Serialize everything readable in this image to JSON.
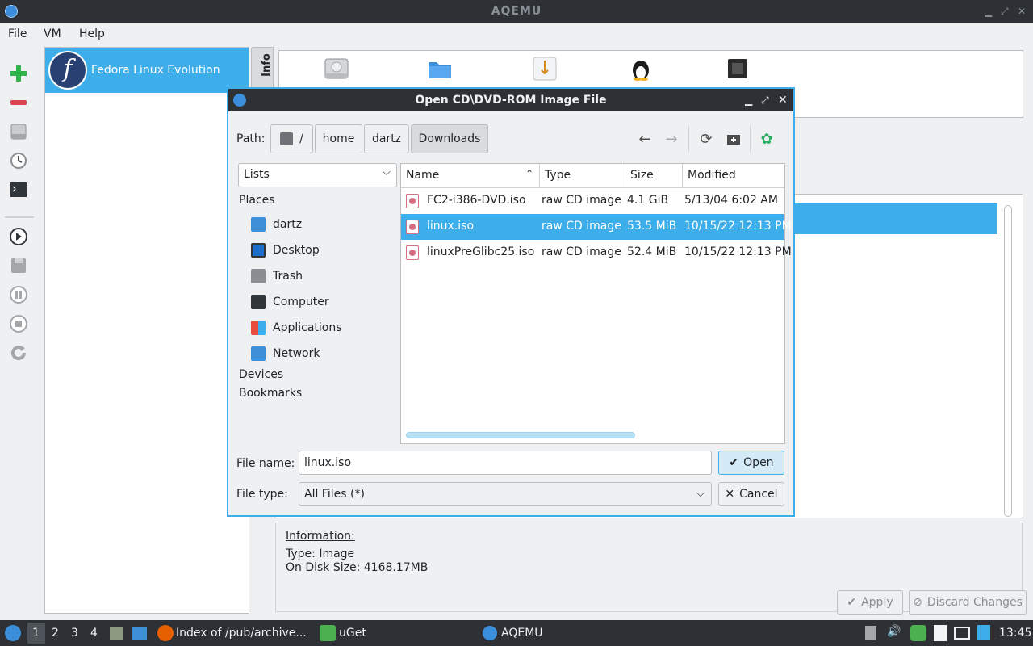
{
  "window": {
    "title": "AQEMU"
  },
  "menubar": {
    "items": [
      "File",
      "VM",
      "Help"
    ]
  },
  "vm_list": {
    "items": [
      {
        "name": "Fedora Linux Evolution",
        "logo_letter": "f"
      }
    ]
  },
  "info_tab": {
    "label": "Info"
  },
  "info_section": {
    "heading": "Information:",
    "type_line": "Type: Image",
    "disk_line": "On Disk Size: 4168.17MB"
  },
  "footer_buttons": {
    "apply": "Apply",
    "discard": "Discard Changes"
  },
  "dialog": {
    "title": "Open CD\\DVD-ROM Image File",
    "path_label": "Path:",
    "path_segments": [
      "/",
      "home",
      "dartz",
      "Downloads"
    ],
    "sidebar_combo": "Lists",
    "places_heading": "Places",
    "places": [
      "dartz",
      "Desktop",
      "Trash",
      "Computer",
      "Applications",
      "Network"
    ],
    "devices_heading": "Devices",
    "bookmarks_heading": "Bookmarks",
    "columns": [
      "Name",
      "Type",
      "Size",
      "Modified"
    ],
    "files": [
      {
        "name": "FC2-i386-DVD.iso",
        "type": "raw CD image",
        "size": "4.1 GiB",
        "modified": "5/13/04 6:02 AM"
      },
      {
        "name": "linux.iso",
        "type": "raw CD image",
        "size": "53.5 MiB",
        "modified": "10/15/22 12:13 PM"
      },
      {
        "name": "linuxPreGlibc25.iso",
        "type": "raw CD image",
        "size": "52.4 MiB",
        "modified": "10/15/22 12:13 PM"
      }
    ],
    "selected_file_index": 1,
    "file_name_label": "File name:",
    "file_name_value": "linux.iso",
    "file_type_label": "File type:",
    "file_type_value": "All Files (*)",
    "open_button": "Open",
    "cancel_button": "Cancel"
  },
  "taskbar": {
    "workspaces": [
      "1",
      "2",
      "3",
      "4"
    ],
    "tasks": [
      "Index of /pub/archive...",
      "uGet",
      "AQEMU"
    ],
    "clock": "13:45"
  },
  "colors": {
    "accent": "#3daee9",
    "titlebar": "#2d3136",
    "background": "#eff0f1"
  }
}
